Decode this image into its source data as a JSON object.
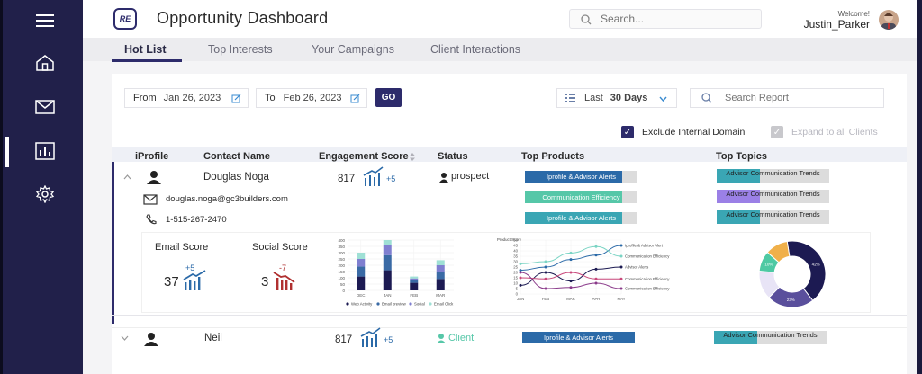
{
  "header": {
    "title": "Opportunity Dashboard",
    "logo_text": "RE",
    "search_placeholder": "Search...",
    "welcome": "Welcome!",
    "username": "Justin_Parker"
  },
  "tabs": [
    {
      "label": "Hot List",
      "active": true
    },
    {
      "label": "Top Interests",
      "active": false
    },
    {
      "label": "Your Campaigns",
      "active": false
    },
    {
      "label": "Client Interactions",
      "active": false
    }
  ],
  "filters": {
    "from_label": "From",
    "from_date": "Jan 26, 2023",
    "to_label": "To",
    "to_date": "Feb 26, 2023",
    "go_label": "GO",
    "period_label": "Last",
    "period_value": "30 Days",
    "search_report_placeholder": "Search Report",
    "exclude_internal_label": "Exclude Internal Domain",
    "exclude_internal_checked": true,
    "expand_clients_label": "Expand to all Clients",
    "expand_clients_checked": true
  },
  "table": {
    "columns": [
      "iProfile",
      "Contact Name",
      "Engagement Score",
      "Status",
      "Top Products",
      "Top Topics"
    ],
    "rows": [
      {
        "name": "Douglas Noga",
        "score": "817",
        "score_delta": "+5",
        "status": "prospect",
        "email": "douglas.noga@gc3builders.com",
        "phone": "1-515-267-2470",
        "products": [
          {
            "label": "Iprofile & Advisor Alerts",
            "percent": 86,
            "color": "#2b6aa8"
          },
          {
            "label": "Communication Efficiency",
            "percent": 86,
            "color": "#56c7a8"
          },
          {
            "label": "Iprofile & Advisor Alerts",
            "percent": 86,
            "color": "#3aa6b4"
          }
        ],
        "topics": [
          {
            "label": "Advisor Communication Trends",
            "percent": 38,
            "color": "#3aa6b4"
          },
          {
            "label": "Advisor Communication Trends",
            "percent": 38,
            "color": "#9b80e6"
          },
          {
            "label": "Advisor Communication Trends",
            "percent": 38,
            "color": "#3aa6b4"
          }
        ],
        "email_score": {
          "label": "Email Score",
          "value": "37",
          "delta": "+5"
        },
        "social_score": {
          "label": "Social Score",
          "value": "3",
          "delta": "-7"
        }
      },
      {
        "name": "Neil",
        "score": "817",
        "score_delta": "+5",
        "status": "Client",
        "products": [
          {
            "label": "Iprofile & Advisor Alerts",
            "percent": 100,
            "color": "#2b6aa8"
          }
        ],
        "topics": [
          {
            "label": "Advisor Communication Trends",
            "percent": 38,
            "color": "#3aa6b4"
          }
        ]
      }
    ]
  },
  "chart_data": [
    {
      "type": "bar",
      "stacked": true,
      "categories": [
        "DEC",
        "JAN",
        "FEB",
        "MAR"
      ],
      "ylim": [
        0,
        400
      ],
      "yticks": [
        0,
        50,
        100,
        150,
        200,
        250,
        300,
        350,
        400
      ],
      "series": [
        {
          "name": "Web Activity",
          "color": "#1c1a52",
          "values": [
            110,
            160,
            60,
            90
          ]
        },
        {
          "name": "Email preview",
          "color": "#3a6aa5",
          "values": [
            80,
            120,
            20,
            60
          ]
        },
        {
          "name": "Social",
          "color": "#7f7fd0",
          "values": [
            60,
            80,
            15,
            50
          ]
        },
        {
          "name": "Email Click",
          "color": "#9fe0d5",
          "values": [
            50,
            40,
            15,
            40
          ]
        }
      ],
      "legend": "bottom"
    },
    {
      "type": "line",
      "ylabel": "Product Score",
      "categories": [
        "JAN",
        "FEB",
        "MAR",
        "APR",
        "MAY"
      ],
      "ylim": [
        0,
        50
      ],
      "yticks": [
        0,
        5,
        10,
        15,
        20,
        25,
        30,
        35,
        40,
        45,
        50
      ],
      "series": [
        {
          "name": "Iprofile & Advisor Alert",
          "color": "#2b6aa8",
          "values": [
            22,
            25,
            32,
            36,
            45
          ]
        },
        {
          "name": "Communication Efficiency",
          "color": "#7ad4c4",
          "values": [
            28,
            30,
            38,
            44,
            35
          ]
        },
        {
          "name": "Advisor Alerts",
          "color": "#1c1a52",
          "values": [
            8,
            20,
            12,
            23,
            25
          ]
        },
        {
          "name": "Communication Efficiency",
          "color": "#c9477a",
          "values": [
            15,
            14,
            20,
            14,
            14
          ]
        },
        {
          "name": "Communication Efficiency",
          "color": "#8a3a8a",
          "values": [
            20,
            5,
            6,
            10,
            5
          ]
        }
      ]
    },
    {
      "type": "pie",
      "donut": true,
      "slices": [
        {
          "label": "42%",
          "value": 42,
          "color": "#1c1a52"
        },
        {
          "label": "23%",
          "value": 23,
          "color": "#5a4f9c"
        },
        {
          "label": "",
          "value": 14,
          "color": "#e8e4f6"
        },
        {
          "label": "10%",
          "value": 10,
          "color": "#4ec9a3"
        },
        {
          "label": "",
          "value": 11,
          "color": "#f0b04a"
        }
      ]
    }
  ]
}
